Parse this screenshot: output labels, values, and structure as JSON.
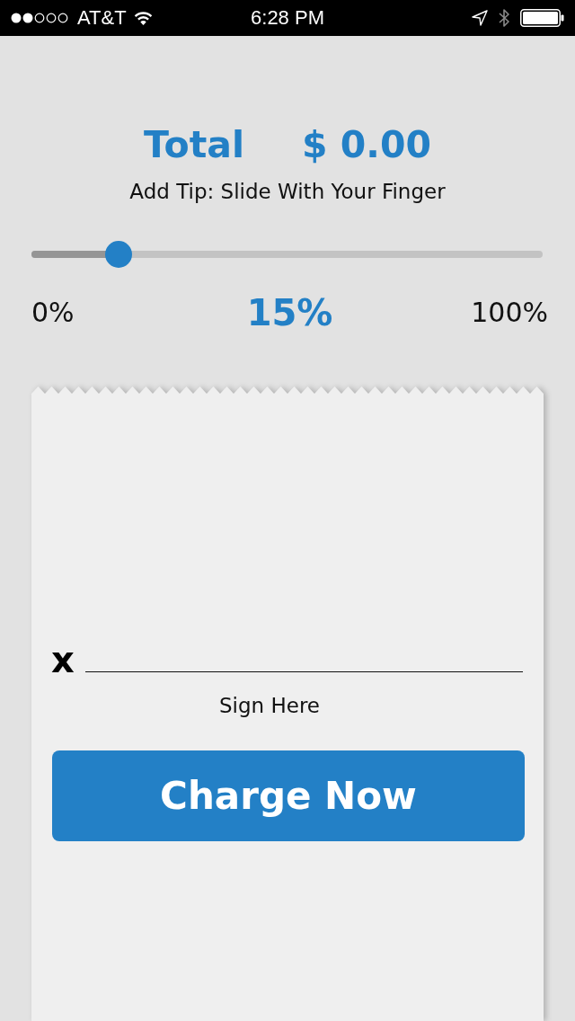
{
  "status_bar": {
    "carrier": "AT&T",
    "time": "6:28 PM"
  },
  "total": {
    "label": "Total",
    "amount": "$ 0.00"
  },
  "tip": {
    "instruction": "Add Tip: Slide With Your Finger",
    "slider": {
      "level": 0.17
    },
    "min_label": "0%",
    "value_label": "15%",
    "max_label": "100%"
  },
  "signature": {
    "mark": "x",
    "caption": "Sign Here"
  },
  "charge_button": {
    "label": "Charge Now"
  }
}
